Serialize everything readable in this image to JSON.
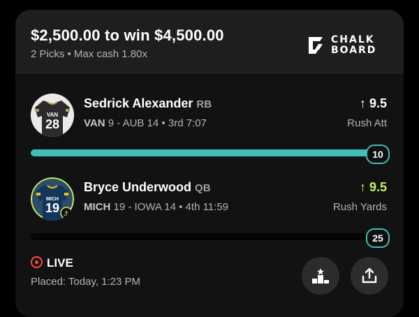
{
  "header": {
    "title": "$2,500.00 to win $4,500.00",
    "subtitle": "2 Picks • Max cash 1.80x",
    "logo_line1": "CHALK",
    "logo_line2": "BOARD"
  },
  "picks": [
    {
      "name": "Sedrick Alexander",
      "position": "RB",
      "team_abbr": "VAN",
      "jersey_number": "28",
      "game_team1": "VAN",
      "game_line": " 9 - AUB 14 • 3rd 7:07",
      "arrow": "↑",
      "line_value": "9.5",
      "stat": "Rush Att",
      "progress_value": "10",
      "progress_fraction": 1.0,
      "bar_color": "#3fbfb8",
      "line_color": "#ffffff"
    },
    {
      "name": "Bryce Underwood",
      "position": "QB",
      "team_abbr": "MICH",
      "jersey_number": "19",
      "game_team1": "MICH",
      "game_line": " 19 - IOWA 14 • 4th 11:59",
      "arrow": "↑",
      "line_value": "9.5",
      "stat": "Rush Yards",
      "progress_value": "25",
      "progress_fraction": 1.0,
      "bar_color": "#050505",
      "line_color": "#c6f25e"
    }
  ],
  "status": {
    "live_label": "LIVE",
    "placed": "Placed: Today, 1:23 PM"
  },
  "actions": {
    "leaderboard_icon": "leaderboard-icon",
    "share_icon": "share-icon"
  },
  "colors": {
    "live_red": "#ff4a3d",
    "teal": "#3fbfb8",
    "lime": "#c6f25e"
  }
}
